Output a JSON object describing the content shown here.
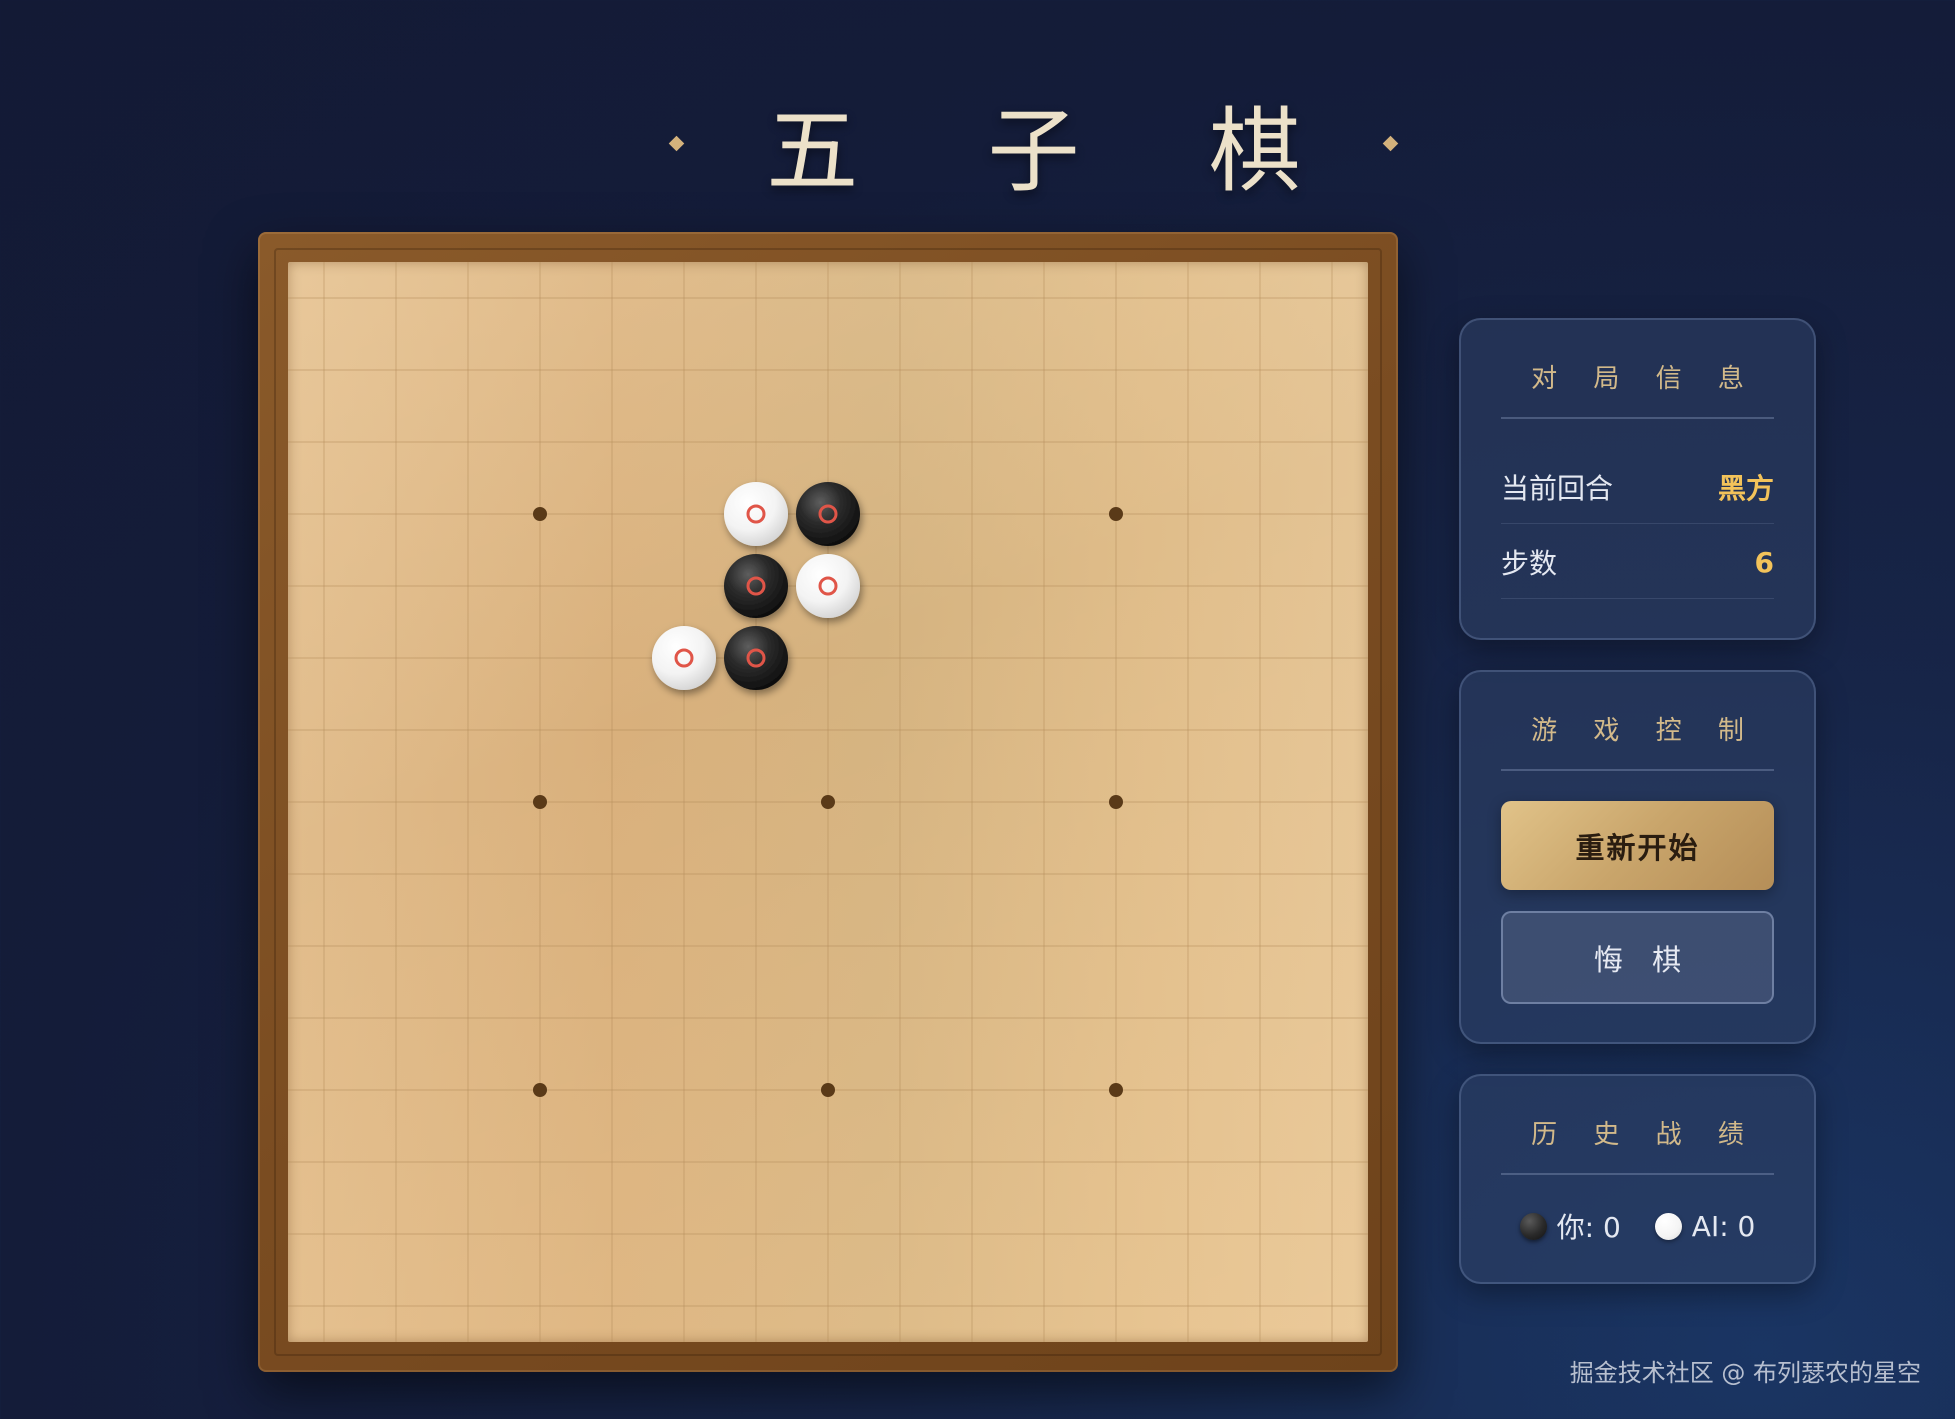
{
  "title": "五 子 棋",
  "board": {
    "size": 15,
    "star_points": [
      {
        "col": 3,
        "row": 3
      },
      {
        "col": 11,
        "row": 3
      },
      {
        "col": 3,
        "row": 7
      },
      {
        "col": 7,
        "row": 7
      },
      {
        "col": 11,
        "row": 7
      },
      {
        "col": 3,
        "row": 11
      },
      {
        "col": 7,
        "row": 11
      },
      {
        "col": 11,
        "row": 11
      }
    ],
    "stones": [
      {
        "col": 6,
        "row": 3,
        "color": "white"
      },
      {
        "col": 7,
        "row": 3,
        "color": "black"
      },
      {
        "col": 6,
        "row": 4,
        "color": "black"
      },
      {
        "col": 7,
        "row": 4,
        "color": "white"
      },
      {
        "col": 5,
        "row": 5,
        "color": "white"
      },
      {
        "col": 6,
        "row": 5,
        "color": "black"
      }
    ],
    "last_move_marker_color": "#e05548"
  },
  "info_panel": {
    "title": "对 局 信 息",
    "current_turn_label": "当前回合",
    "current_turn_value": "黑方",
    "moves_label": "步数",
    "moves_value": "6"
  },
  "control_panel": {
    "title": "游 戏 控 制",
    "restart_label": "重新开始",
    "undo_label": "悔 棋"
  },
  "history_panel": {
    "title": "历 史 战 绩",
    "player_score": "你: 0",
    "ai_score": "AI: 0"
  },
  "watermark": "掘金技术社区 @ 布列瑟农的星空",
  "colors": {
    "accent_gold": "#f3c35a",
    "panel_title": "#d2b98a",
    "board_line": "#b58f5e",
    "star_point": "#5a3a18"
  }
}
